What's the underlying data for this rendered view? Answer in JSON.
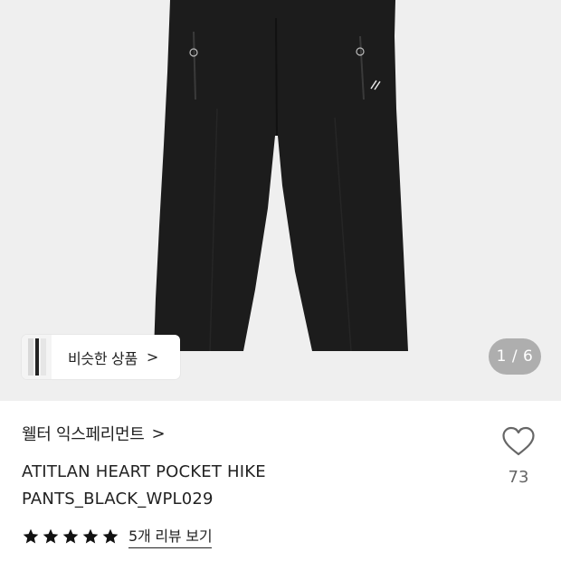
{
  "gallery": {
    "similar_button_label": "비슷한 상품",
    "similar_button_chevron": ">",
    "page_indicator": "1 / 6"
  },
  "product": {
    "brand": "웰터 익스페리먼트",
    "brand_chevron": ">",
    "name": "ATITLAN HEART POCKET HIKE PANTS_BLACK_WPL029",
    "like_count": "73",
    "rating": 5,
    "review_link": "5개 리뷰 보기"
  },
  "colors": {
    "hero_background": "#efefef",
    "pants": "#1c1c1c",
    "text": "#222222",
    "muted": "#666666"
  }
}
